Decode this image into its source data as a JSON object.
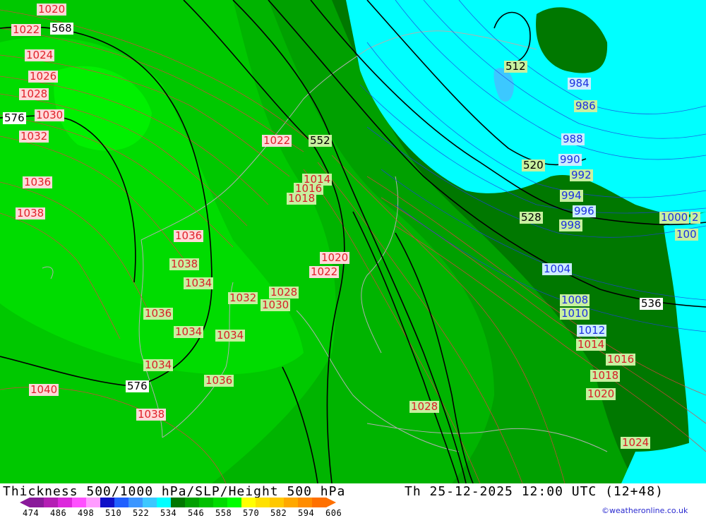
{
  "title": "Thickness 500/1000 hPa/SLP/Height 500 hPa",
  "valid_time": "Th 25-12-2025 12:00 UTC (12+48)",
  "credit": "©weatheronline.co.uk",
  "legend": {
    "ticks": [
      "474",
      "486",
      "498",
      "510",
      "522",
      "534",
      "546",
      "558",
      "570",
      "582",
      "594",
      "606"
    ],
    "colors": [
      "#8a1a9a",
      "#b41eb4",
      "#dc28dc",
      "#ff50ff",
      "#ff9cff",
      "#1010c8",
      "#2060ff",
      "#3c96ff",
      "#3cc8ff",
      "#00ffff",
      "#007800",
      "#00a000",
      "#00c000",
      "#00dc00",
      "#00ff00",
      "#ffff00",
      "#ffe000",
      "#ffc800",
      "#ffa800",
      "#ff8c00",
      "#ff7000"
    ]
  },
  "colors": {
    "cold_fill": "#00ffff",
    "dark_green": "#007800",
    "mid_green": "#00b400",
    "bright_green": "#00dc00",
    "isobar": "#d85050",
    "isobar_cold": "#2030e0",
    "height": "#000000"
  },
  "slp_labels": {
    "l1020a": "1020",
    "l1022a": "1022",
    "l1024a": "1024",
    "l1026": "1026",
    "l1028a": "1028",
    "l1030a": "1030",
    "l1032a": "1032",
    "l1036a": "1036",
    "l1038a": "1038",
    "l1022b": "1022",
    "l1014a": "1014",
    "l1016a": "1016",
    "l1018a": "1018",
    "l1036b": "1036",
    "l1038b": "1038",
    "l1034a": "1034",
    "l1020b": "1020",
    "l1022c": "1022",
    "l1032b": "1032",
    "l1028b": "1028",
    "l1030b": "1030",
    "l1036c": "1036",
    "l1034b": "1034",
    "l1034c": "1034",
    "l1034d": "1034",
    "l1036d": "1036",
    "l1040": "1040",
    "l1038c": "1038",
    "l1028c": "1028",
    "l984": "984",
    "l986": "986",
    "l988": "988",
    "l990": "990",
    "l992": "992",
    "l994": "994",
    "l996": "996",
    "l998": "998",
    "l1000": "1000",
    "l1002": "2",
    "l100x": "100",
    "l1004": "1004",
    "l1008": "1008",
    "l1010": "1010",
    "l1012": "1012",
    "l1014b": "1014",
    "l1016b": "1016",
    "l1018b": "1018",
    "l1020c": "1020",
    "l1024b": "1024"
  },
  "height_labels": {
    "h568": "568",
    "h576a": "576",
    "h552": "552",
    "h512": "512",
    "h520": "520",
    "h528": "528",
    "h536": "536",
    "h576b": "576"
  }
}
